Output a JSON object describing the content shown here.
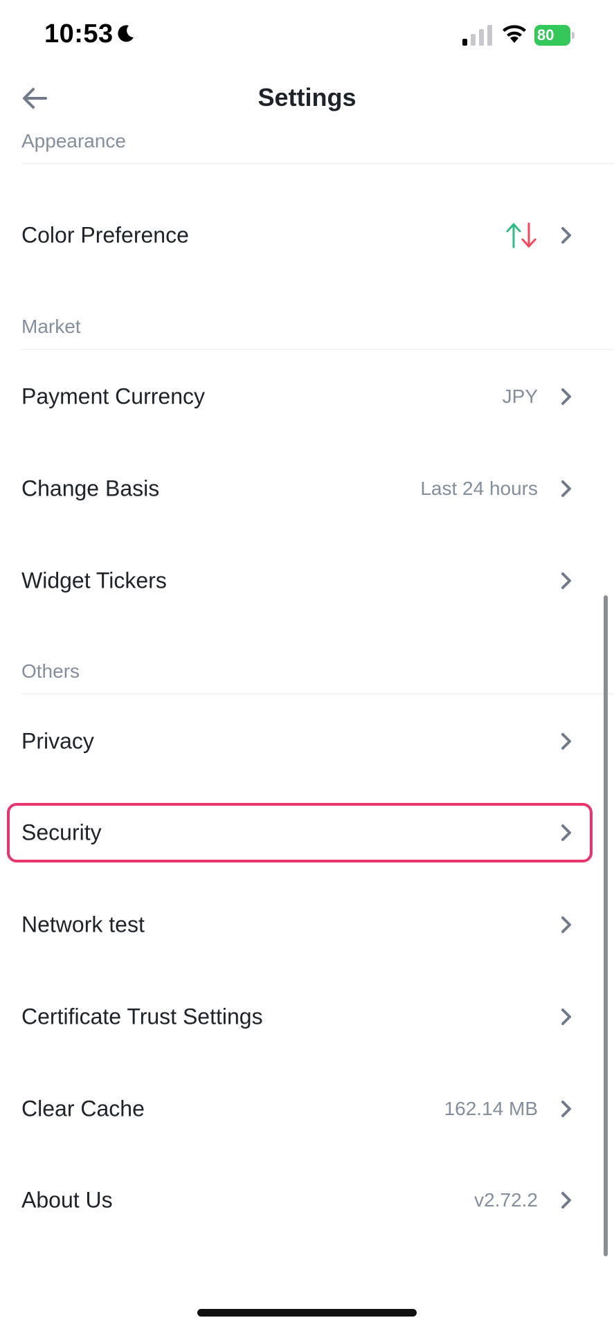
{
  "status_bar": {
    "time": "10:53",
    "battery": "80"
  },
  "header": {
    "title": "Settings"
  },
  "sections": {
    "appearance": {
      "title": "Appearance",
      "rows": [
        {
          "label": "Color Preference",
          "value": ""
        }
      ]
    },
    "market": {
      "title": "Market",
      "rows": [
        {
          "label": "Payment Currency",
          "value": "JPY"
        },
        {
          "label": "Change Basis",
          "value": "Last 24 hours"
        },
        {
          "label": "Widget Tickers",
          "value": ""
        }
      ]
    },
    "others": {
      "title": "Others",
      "rows": [
        {
          "label": "Privacy",
          "value": ""
        },
        {
          "label": "Security",
          "value": ""
        },
        {
          "label": "Network test",
          "value": ""
        },
        {
          "label": "Certificate Trust Settings",
          "value": ""
        },
        {
          "label": "Clear Cache",
          "value": "162.14 MB"
        },
        {
          "label": "About Us",
          "value": "v2.72.2"
        }
      ]
    }
  },
  "colors": {
    "up": "#2ebd85",
    "down": "#f6465d",
    "highlight": "#e8336d",
    "muted_text": "#848e9c",
    "primary_text": "#1e2329"
  },
  "icons": {
    "back": "arrow-left-icon",
    "chevron": "chevron-right-icon",
    "color_preference": "up-down-arrows-icon"
  }
}
